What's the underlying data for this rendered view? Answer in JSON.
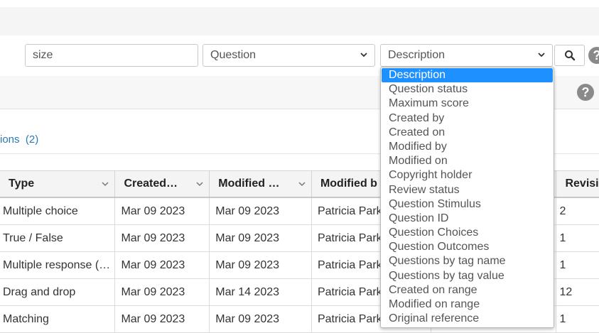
{
  "search": {
    "keyword_value": "size",
    "type_select": "Question",
    "field_select": "Description",
    "help_label": "?"
  },
  "toolbar": {
    "help_label": "?"
  },
  "link": {
    "text": "ions",
    "count": "(2)"
  },
  "table": {
    "headers": [
      "Type",
      "Created…",
      "Modified …",
      "Modified b",
      "Revisi"
    ],
    "rows": [
      {
        "type": "Multiple choice",
        "created": "Mar 09 2023",
        "modified": "Mar 09 2023",
        "modified_by": "Patricia Park",
        "revision": "2"
      },
      {
        "type": "True / False",
        "created": "Mar 09 2023",
        "modified": "Mar 09 2023",
        "modified_by": "Patricia Park",
        "revision": "1"
      },
      {
        "type": "Multiple response (…",
        "created": "Mar 09 2023",
        "modified": "Mar 09 2023",
        "modified_by": "Patricia Park",
        "revision": "1"
      },
      {
        "type": "Drag and drop",
        "created": "Mar 09 2023",
        "modified": "Mar 14 2023",
        "modified_by": "Patricia Park",
        "revision": "12"
      },
      {
        "type": "Matching",
        "created": "Mar 09 2023",
        "modified": "Mar 09 2023",
        "modified_by": "Patricia Park",
        "revision": "1"
      }
    ]
  },
  "dropdown": {
    "selected_index": 0,
    "options": [
      "Description",
      "Question status",
      "Maximum score",
      "Created by",
      "Created on",
      "Modified by",
      "Modified on",
      "Copyright holder",
      "Review status",
      "Question Stimulus",
      "Question ID",
      "Question Choices",
      "Question Outcomes",
      "Questions by tag name",
      "Questions by tag value",
      "Created on range",
      "Modified on range",
      "Original reference"
    ]
  },
  "colors": {
    "accent": "#1e90ff",
    "link": "#2a7ab8",
    "icon_gray": "#8a8a8a"
  }
}
